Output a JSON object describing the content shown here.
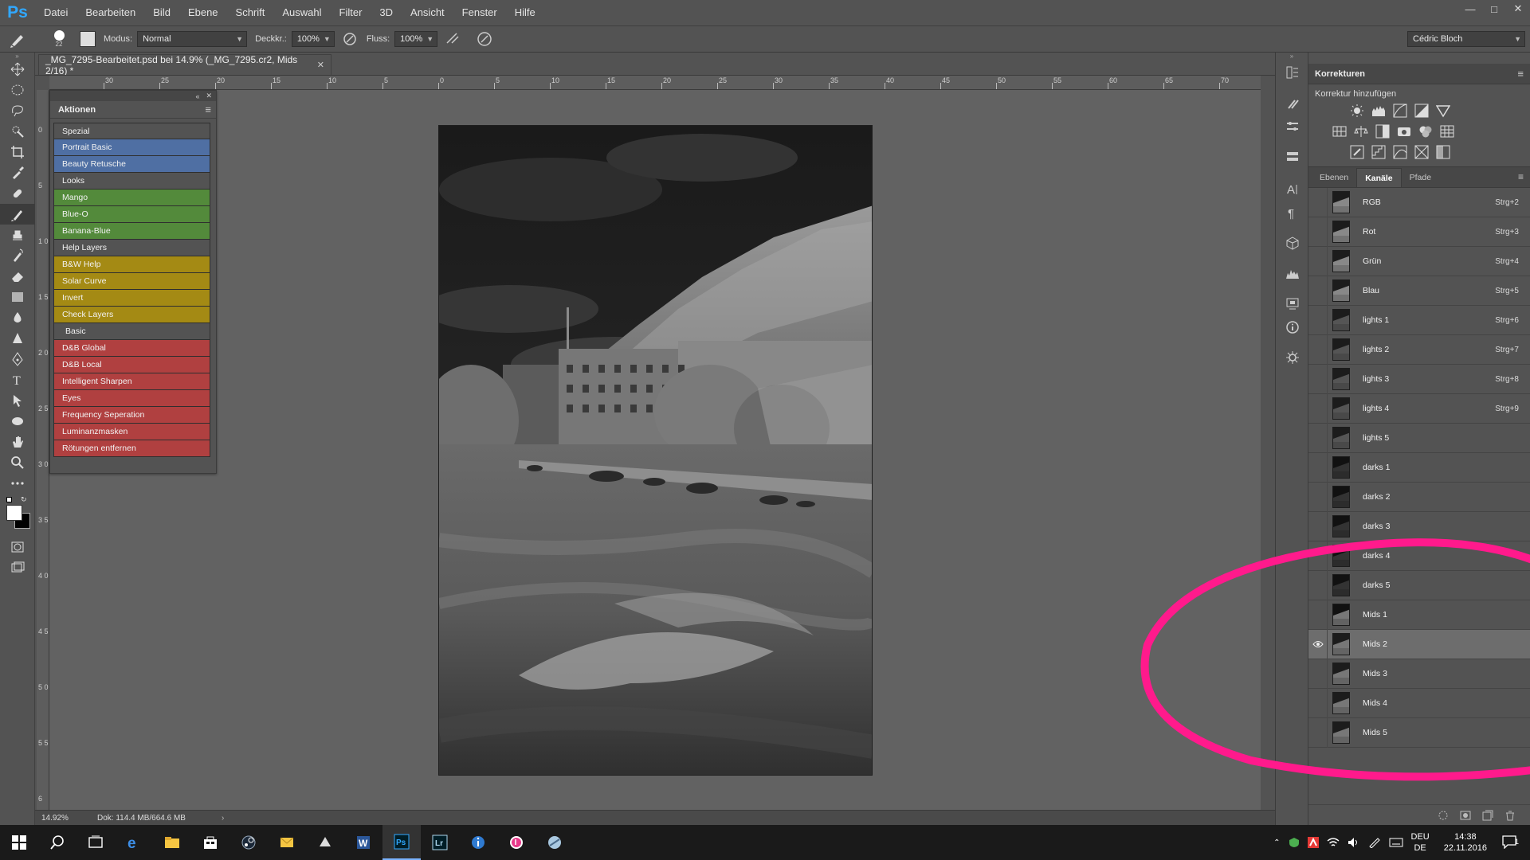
{
  "app": {
    "logo": "Ps"
  },
  "menu": [
    "Datei",
    "Bearbeiten",
    "Bild",
    "Ebene",
    "Schrift",
    "Auswahl",
    "Filter",
    "3D",
    "Ansicht",
    "Fenster",
    "Hilfe"
  ],
  "options": {
    "brush_size": "22",
    "mode_label": "Modus:",
    "mode_value": "Normal",
    "opacity_label": "Deckkr.:",
    "opacity_value": "100%",
    "flow_label": "Fluss:",
    "flow_value": "100%",
    "workspace": "Cédric Bloch"
  },
  "document": {
    "tab_title": "_MG_7295-Bearbeitet.psd bei 14.9% (_MG_7295.cr2, Mids 2/16) *"
  },
  "ruler": {
    "h_labels": [
      "30",
      "25",
      "20",
      "15",
      "10",
      "5",
      "0",
      "5",
      "10",
      "15",
      "20",
      "25",
      "30",
      "35",
      "40",
      "45",
      "50",
      "55",
      "60",
      "65",
      "70"
    ],
    "v_labels": [
      "0",
      "5",
      "1 0",
      "1 5",
      "2 0",
      "2 5",
      "3 0",
      "3 5",
      "4 0",
      "4 5",
      "5 0",
      "5 5",
      "6"
    ]
  },
  "actions": {
    "title": "Aktionen",
    "items": [
      {
        "label": "Spezial",
        "color": "#535353"
      },
      {
        "label": "Portrait Basic",
        "color": "#4f6fa3"
      },
      {
        "label": "Beauty Retusche",
        "color": "#4f6fa3"
      },
      {
        "label": "Looks",
        "color": "#535353"
      },
      {
        "label": "Mango",
        "color": "#538a3b"
      },
      {
        "label": "Blue-O",
        "color": "#538a3b"
      },
      {
        "label": "Banana-Blue",
        "color": "#538a3b"
      },
      {
        "label": "Help Layers",
        "color": "#535353"
      },
      {
        "label": "B&W Help",
        "color": "#a48a14"
      },
      {
        "label": "Solar Curve",
        "color": "#a48a14"
      },
      {
        "label": "Invert",
        "color": "#a48a14"
      },
      {
        "label": "Check Layers",
        "color": "#a48a14"
      },
      {
        "label": "Basic",
        "color": "#535353"
      },
      {
        "label": "D&B Global",
        "color": "#b04040"
      },
      {
        "label": "D&B Local",
        "color": "#b04040"
      },
      {
        "label": "Intelligent Sharpen",
        "color": "#b04040"
      },
      {
        "label": "Eyes",
        "color": "#b04040"
      },
      {
        "label": "Frequency Seperation",
        "color": "#b04040"
      },
      {
        "label": "Luminanzmasken",
        "color": "#b04040"
      },
      {
        "label": "Rötungen entfernen",
        "color": "#b04040"
      }
    ]
  },
  "adjustments": {
    "title": "Korrekturen",
    "subtitle": "Korrektur hinzufügen"
  },
  "channels_panel": {
    "tabs": [
      "Ebenen",
      "Kanäle",
      "Pfade"
    ],
    "active_tab": "Kanäle",
    "rows": [
      {
        "name": "RGB",
        "shortcut": "Strg+2",
        "visible": false
      },
      {
        "name": "Rot",
        "shortcut": "Strg+3",
        "visible": false
      },
      {
        "name": "Grün",
        "shortcut": "Strg+4",
        "visible": false
      },
      {
        "name": "Blau",
        "shortcut": "Strg+5",
        "visible": false
      },
      {
        "name": "lights 1",
        "shortcut": "Strg+6",
        "visible": false
      },
      {
        "name": "lights 2",
        "shortcut": "Strg+7",
        "visible": false
      },
      {
        "name": "lights 3",
        "shortcut": "Strg+8",
        "visible": false
      },
      {
        "name": "lights 4",
        "shortcut": "Strg+9",
        "visible": false
      },
      {
        "name": "lights 5",
        "shortcut": "",
        "visible": false
      },
      {
        "name": "darks 1",
        "shortcut": "",
        "visible": false
      },
      {
        "name": "darks 2",
        "shortcut": "",
        "visible": false
      },
      {
        "name": "darks 3",
        "shortcut": "",
        "visible": false
      },
      {
        "name": "darks 4",
        "shortcut": "",
        "visible": false
      },
      {
        "name": "darks 5",
        "shortcut": "",
        "visible": false
      },
      {
        "name": "Mids 1",
        "shortcut": "",
        "visible": false
      },
      {
        "name": "Mids 2",
        "shortcut": "",
        "visible": true
      },
      {
        "name": "Mids 3",
        "shortcut": "",
        "visible": false
      },
      {
        "name": "Mids 4",
        "shortcut": "",
        "visible": false
      },
      {
        "name": "Mids 5",
        "shortcut": "",
        "visible": false
      }
    ],
    "selected": "Mids 2"
  },
  "status": {
    "zoom": "14.92%",
    "doc": "Dok: 114.4 MB/664.6 MB"
  },
  "taskbar": {
    "apps": [
      "start-icon",
      "search-icon",
      "task-view-icon",
      "edge-icon",
      "explorer-icon",
      "store-icon",
      "steam-icon",
      "mail-icon",
      "app-icon",
      "word-icon",
      "photoshop-icon",
      "lightroom-icon",
      "info-icon",
      "itunes-icon",
      "app2-icon"
    ],
    "active": "photoshop-icon",
    "lang_top": "DEU",
    "lang_bottom": "DE",
    "time": "14:38",
    "date": "22.11.2016",
    "notifications": "1"
  },
  "colors": {
    "annotation": "#ff1a8c",
    "accent": "#31a8ff"
  }
}
